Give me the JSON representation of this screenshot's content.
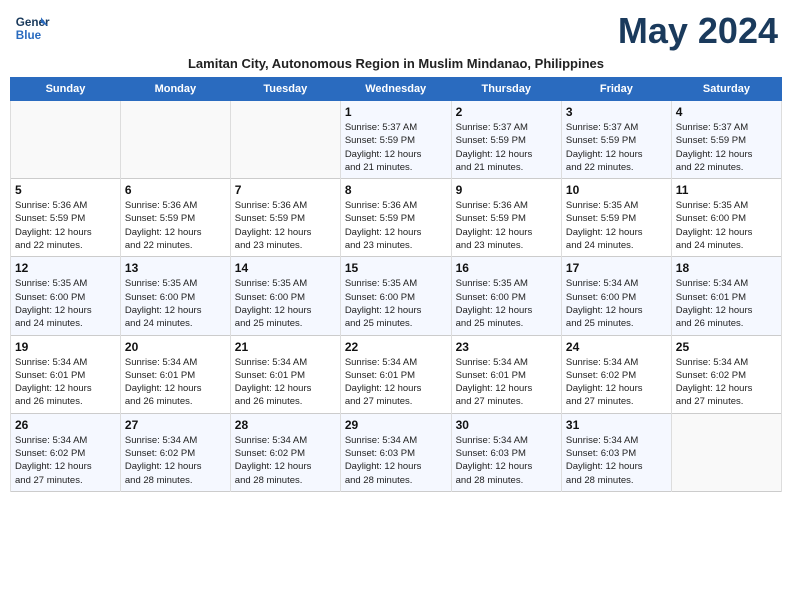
{
  "header": {
    "logo_line1": "General",
    "logo_line2": "Blue",
    "month_title": "May 2024",
    "subtitle": "Lamitan City, Autonomous Region in Muslim Mindanao, Philippines"
  },
  "days_of_week": [
    "Sunday",
    "Monday",
    "Tuesday",
    "Wednesday",
    "Thursday",
    "Friday",
    "Saturday"
  ],
  "weeks": [
    [
      {
        "day": "",
        "info": ""
      },
      {
        "day": "",
        "info": ""
      },
      {
        "day": "",
        "info": ""
      },
      {
        "day": "1",
        "info": "Sunrise: 5:37 AM\nSunset: 5:59 PM\nDaylight: 12 hours\nand 21 minutes."
      },
      {
        "day": "2",
        "info": "Sunrise: 5:37 AM\nSunset: 5:59 PM\nDaylight: 12 hours\nand 21 minutes."
      },
      {
        "day": "3",
        "info": "Sunrise: 5:37 AM\nSunset: 5:59 PM\nDaylight: 12 hours\nand 22 minutes."
      },
      {
        "day": "4",
        "info": "Sunrise: 5:37 AM\nSunset: 5:59 PM\nDaylight: 12 hours\nand 22 minutes."
      }
    ],
    [
      {
        "day": "5",
        "info": "Sunrise: 5:36 AM\nSunset: 5:59 PM\nDaylight: 12 hours\nand 22 minutes."
      },
      {
        "day": "6",
        "info": "Sunrise: 5:36 AM\nSunset: 5:59 PM\nDaylight: 12 hours\nand 22 minutes."
      },
      {
        "day": "7",
        "info": "Sunrise: 5:36 AM\nSunset: 5:59 PM\nDaylight: 12 hours\nand 23 minutes."
      },
      {
        "day": "8",
        "info": "Sunrise: 5:36 AM\nSunset: 5:59 PM\nDaylight: 12 hours\nand 23 minutes."
      },
      {
        "day": "9",
        "info": "Sunrise: 5:36 AM\nSunset: 5:59 PM\nDaylight: 12 hours\nand 23 minutes."
      },
      {
        "day": "10",
        "info": "Sunrise: 5:35 AM\nSunset: 5:59 PM\nDaylight: 12 hours\nand 24 minutes."
      },
      {
        "day": "11",
        "info": "Sunrise: 5:35 AM\nSunset: 6:00 PM\nDaylight: 12 hours\nand 24 minutes."
      }
    ],
    [
      {
        "day": "12",
        "info": "Sunrise: 5:35 AM\nSunset: 6:00 PM\nDaylight: 12 hours\nand 24 minutes."
      },
      {
        "day": "13",
        "info": "Sunrise: 5:35 AM\nSunset: 6:00 PM\nDaylight: 12 hours\nand 24 minutes."
      },
      {
        "day": "14",
        "info": "Sunrise: 5:35 AM\nSunset: 6:00 PM\nDaylight: 12 hours\nand 25 minutes."
      },
      {
        "day": "15",
        "info": "Sunrise: 5:35 AM\nSunset: 6:00 PM\nDaylight: 12 hours\nand 25 minutes."
      },
      {
        "day": "16",
        "info": "Sunrise: 5:35 AM\nSunset: 6:00 PM\nDaylight: 12 hours\nand 25 minutes."
      },
      {
        "day": "17",
        "info": "Sunrise: 5:34 AM\nSunset: 6:00 PM\nDaylight: 12 hours\nand 25 minutes."
      },
      {
        "day": "18",
        "info": "Sunrise: 5:34 AM\nSunset: 6:01 PM\nDaylight: 12 hours\nand 26 minutes."
      }
    ],
    [
      {
        "day": "19",
        "info": "Sunrise: 5:34 AM\nSunset: 6:01 PM\nDaylight: 12 hours\nand 26 minutes."
      },
      {
        "day": "20",
        "info": "Sunrise: 5:34 AM\nSunset: 6:01 PM\nDaylight: 12 hours\nand 26 minutes."
      },
      {
        "day": "21",
        "info": "Sunrise: 5:34 AM\nSunset: 6:01 PM\nDaylight: 12 hours\nand 26 minutes."
      },
      {
        "day": "22",
        "info": "Sunrise: 5:34 AM\nSunset: 6:01 PM\nDaylight: 12 hours\nand 27 minutes."
      },
      {
        "day": "23",
        "info": "Sunrise: 5:34 AM\nSunset: 6:01 PM\nDaylight: 12 hours\nand 27 minutes."
      },
      {
        "day": "24",
        "info": "Sunrise: 5:34 AM\nSunset: 6:02 PM\nDaylight: 12 hours\nand 27 minutes."
      },
      {
        "day": "25",
        "info": "Sunrise: 5:34 AM\nSunset: 6:02 PM\nDaylight: 12 hours\nand 27 minutes."
      }
    ],
    [
      {
        "day": "26",
        "info": "Sunrise: 5:34 AM\nSunset: 6:02 PM\nDaylight: 12 hours\nand 27 minutes."
      },
      {
        "day": "27",
        "info": "Sunrise: 5:34 AM\nSunset: 6:02 PM\nDaylight: 12 hours\nand 28 minutes."
      },
      {
        "day": "28",
        "info": "Sunrise: 5:34 AM\nSunset: 6:02 PM\nDaylight: 12 hours\nand 28 minutes."
      },
      {
        "day": "29",
        "info": "Sunrise: 5:34 AM\nSunset: 6:03 PM\nDaylight: 12 hours\nand 28 minutes."
      },
      {
        "day": "30",
        "info": "Sunrise: 5:34 AM\nSunset: 6:03 PM\nDaylight: 12 hours\nand 28 minutes."
      },
      {
        "day": "31",
        "info": "Sunrise: 5:34 AM\nSunset: 6:03 PM\nDaylight: 12 hours\nand 28 minutes."
      },
      {
        "day": "",
        "info": ""
      }
    ]
  ]
}
